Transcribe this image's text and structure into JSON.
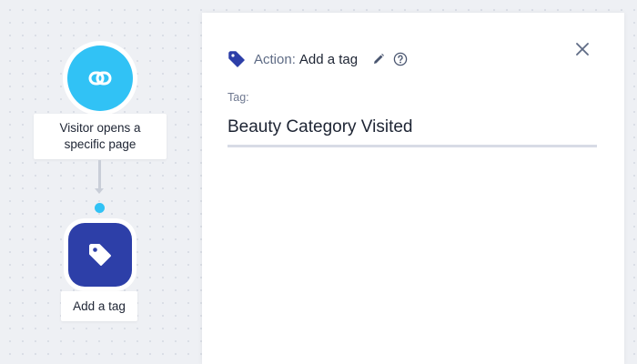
{
  "flow": {
    "trigger": {
      "label": "Visitor opens a specific page",
      "icon": "link-icon",
      "color": "#31c2f5"
    },
    "action": {
      "label": "Add a tag",
      "icon": "tag-icon",
      "color": "#2d3fa8"
    },
    "connector": {
      "dot_color": "#31c2f5"
    }
  },
  "panel": {
    "header": {
      "prefix": "Action:",
      "title": "Add a tag",
      "icons": [
        "tag-icon",
        "edit-icon",
        "help-icon"
      ]
    },
    "close_icon": "close-icon",
    "field": {
      "label": "Tag:",
      "value": "Beauty Category Visited"
    }
  }
}
